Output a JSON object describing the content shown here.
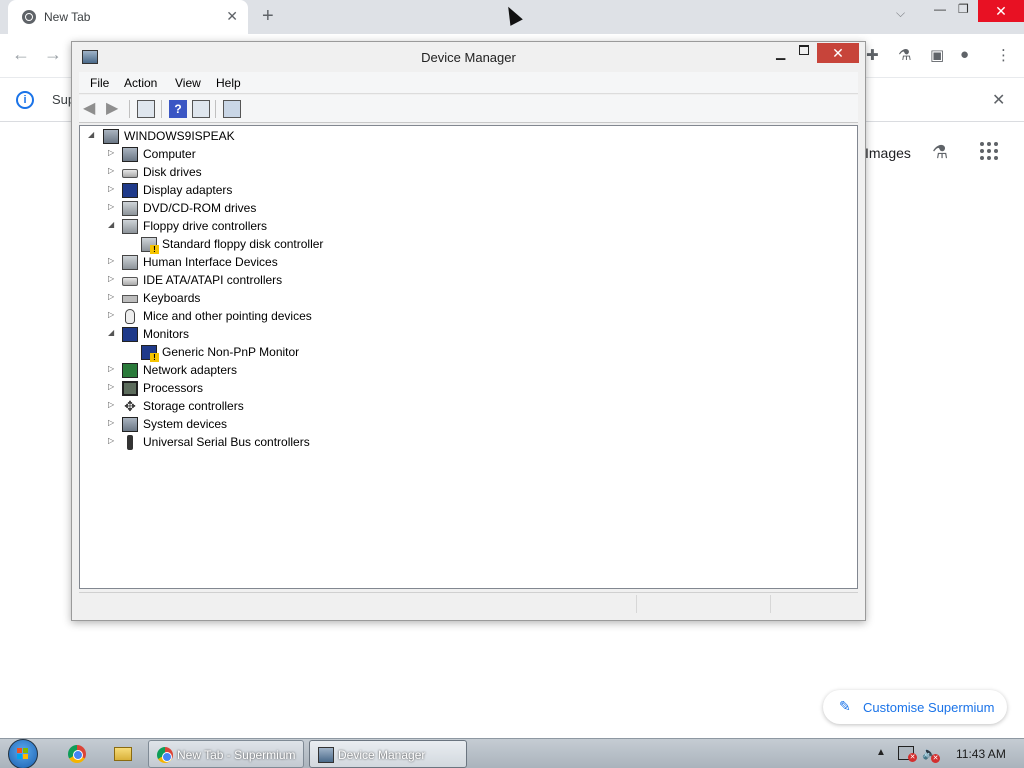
{
  "browser": {
    "tab_title": "New Tab",
    "infobar_text": "Sup",
    "images_label": "Images",
    "customise_label": "Customise Supermium"
  },
  "device_manager": {
    "title": "Device Manager",
    "menu": [
      "File",
      "Action",
      "View",
      "Help"
    ],
    "tree": {
      "root": "WINDOWS9ISPEAK",
      "nodes": [
        {
          "label": "Computer",
          "icon": "computer-icon",
          "expanded": false
        },
        {
          "label": "Disk drives",
          "icon": "disk-drive-icon",
          "expanded": false
        },
        {
          "label": "Display adapters",
          "icon": "display-adapter-icon",
          "expanded": false
        },
        {
          "label": "DVD/CD-ROM drives",
          "icon": "dvd-drive-icon",
          "expanded": false
        },
        {
          "label": "Floppy drive controllers",
          "icon": "floppy-controller-icon",
          "expanded": true,
          "children": [
            {
              "label": "Standard floppy disk controller",
              "icon": "floppy-controller-warning-icon"
            }
          ]
        },
        {
          "label": "Human Interface Devices",
          "icon": "hid-icon",
          "expanded": false
        },
        {
          "label": "IDE ATA/ATAPI controllers",
          "icon": "ide-controller-icon",
          "expanded": false
        },
        {
          "label": "Keyboards",
          "icon": "keyboard-icon",
          "expanded": false
        },
        {
          "label": "Mice and other pointing devices",
          "icon": "mouse-icon",
          "expanded": false
        },
        {
          "label": "Monitors",
          "icon": "monitor-icon",
          "expanded": true,
          "children": [
            {
              "label": "Generic Non-PnP Monitor",
              "icon": "monitor-warning-icon"
            }
          ]
        },
        {
          "label": "Network adapters",
          "icon": "network-adapter-icon",
          "expanded": false
        },
        {
          "label": "Processors",
          "icon": "processor-icon",
          "expanded": false
        },
        {
          "label": "Storage controllers",
          "icon": "storage-controller-icon",
          "expanded": false
        },
        {
          "label": "System devices",
          "icon": "system-devices-icon",
          "expanded": false
        },
        {
          "label": "Universal Serial Bus controllers",
          "icon": "usb-icon",
          "expanded": false
        }
      ]
    }
  },
  "taskbar": {
    "buttons": [
      {
        "label": "New Tab - Supermium",
        "active": false
      },
      {
        "label": "Device Manager",
        "active": true
      }
    ],
    "clock": "11:43 AM"
  }
}
